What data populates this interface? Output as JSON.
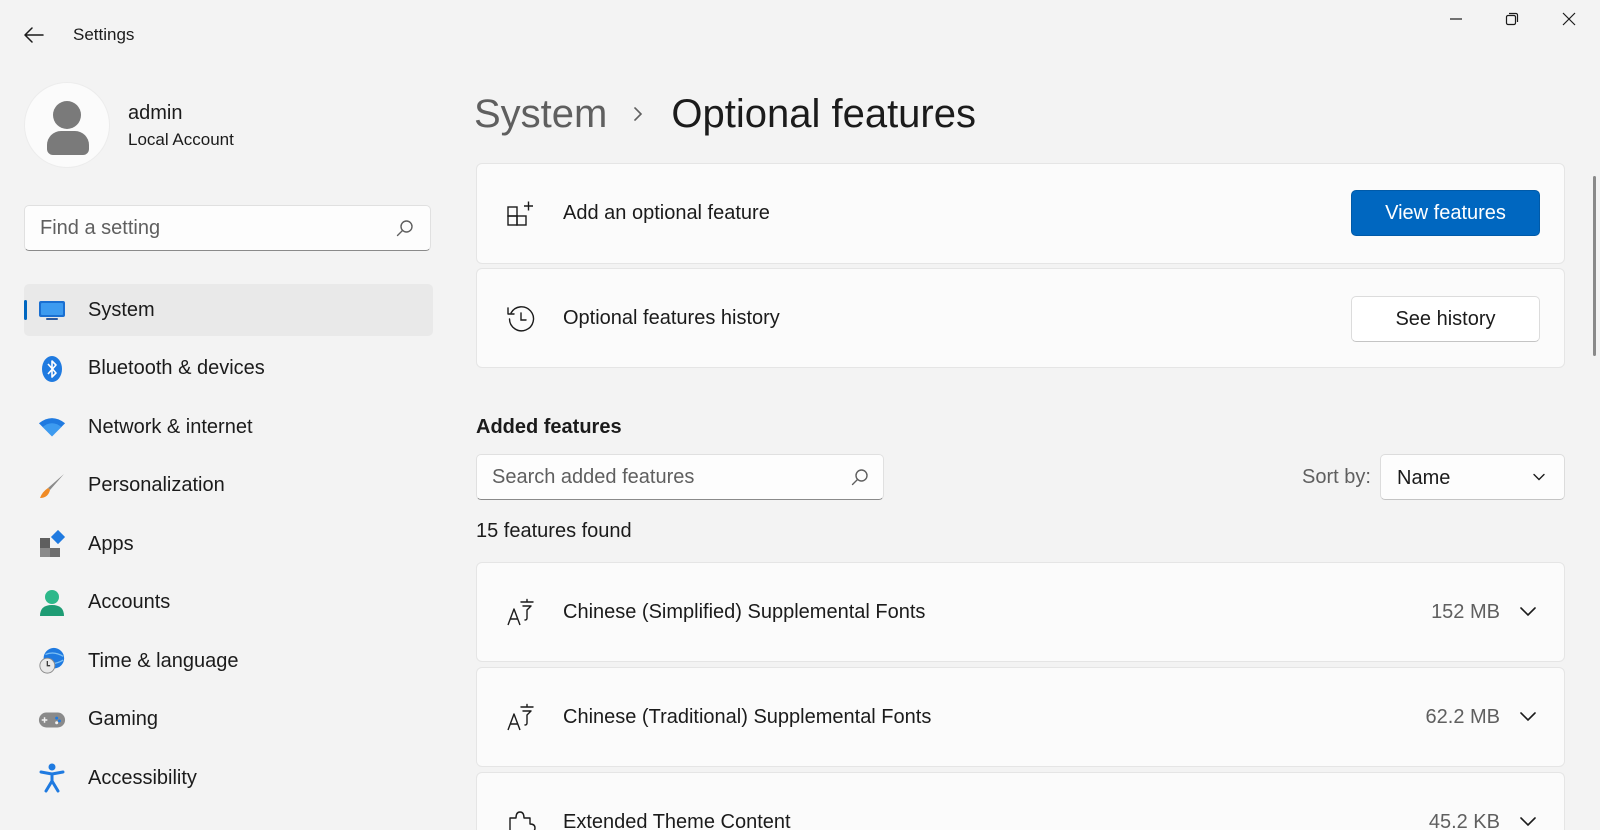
{
  "window": {
    "title": "Settings"
  },
  "profile": {
    "name": "admin",
    "account_type": "Local Account"
  },
  "sidebar": {
    "search_placeholder": "Find a setting",
    "items": [
      {
        "label": "System",
        "icon": "system-icon",
        "active": true
      },
      {
        "label": "Bluetooth & devices",
        "icon": "bluetooth-icon"
      },
      {
        "label": "Network & internet",
        "icon": "wifi-icon"
      },
      {
        "label": "Personalization",
        "icon": "brush-icon"
      },
      {
        "label": "Apps",
        "icon": "apps-icon"
      },
      {
        "label": "Accounts",
        "icon": "accounts-icon"
      },
      {
        "label": "Time & language",
        "icon": "time-language-icon"
      },
      {
        "label": "Gaming",
        "icon": "gamepad-icon"
      },
      {
        "label": "Accessibility",
        "icon": "accessibility-icon"
      }
    ]
  },
  "breadcrumb": {
    "parent": "System",
    "current": "Optional features"
  },
  "add_feature": {
    "label": "Add an optional feature",
    "button": "View features"
  },
  "history": {
    "label": "Optional features history",
    "button": "See history"
  },
  "added_features": {
    "title": "Added features",
    "search_placeholder": "Search added features",
    "sort_label": "Sort by:",
    "sort_value": "Name",
    "count_text": "15 features found",
    "items": [
      {
        "name": "Chinese (Simplified) Supplemental Fonts",
        "size": "152 MB",
        "icon": "font-icon"
      },
      {
        "name": "Chinese (Traditional) Supplemental Fonts",
        "size": "62.2 MB",
        "icon": "font-icon"
      },
      {
        "name": "Extended Theme Content",
        "size": "45.2 KB",
        "icon": "puzzle-icon"
      }
    ]
  },
  "colors": {
    "accent": "#0067c0",
    "background": "#f3f3f3",
    "card": "#fbfbfb"
  }
}
